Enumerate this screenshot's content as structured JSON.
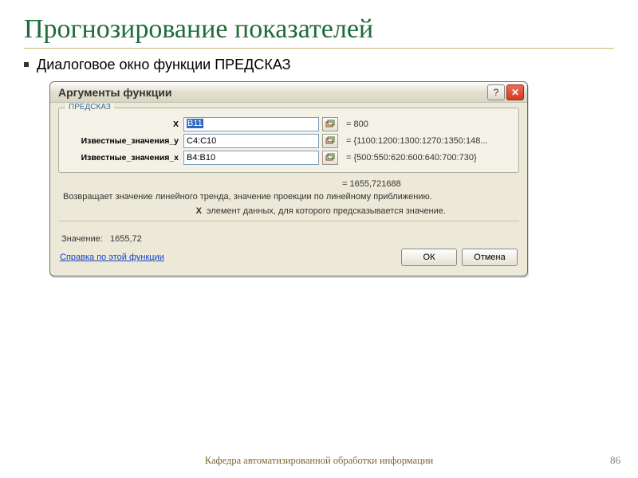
{
  "slide": {
    "title": "Прогнозирование  показателей",
    "bullet": "Диалоговое окно функции ПРЕДСКАЗ",
    "footer": "Кафедра автоматизированной обработки информации",
    "page_number": "86"
  },
  "dialog": {
    "title": "Аргументы функции",
    "help_icon": "?",
    "close_icon": "✕",
    "function_name": "ПРЕДСКАЗ",
    "arguments": [
      {
        "label": "X",
        "value": "B11",
        "highlighted": true,
        "result": "= 800"
      },
      {
        "label": "Известные_значения_y",
        "value": "C4:C10",
        "highlighted": false,
        "result": "= {1100:1200:1300:1270:1350:148..."
      },
      {
        "label": "Известные_значения_x",
        "value": "B4:B10",
        "highlighted": false,
        "result": "= {500:550:620:600:640:700:730}"
      }
    ],
    "overall_result": "= 1655,721688",
    "description": "Возвращает значение линейного тренда, значение проекции по линейному приближению.",
    "current_arg_label": "X",
    "current_arg_desc": "элемент данных, для которого предсказывается значение.",
    "value_label": "Значение:",
    "value": "1655,72",
    "help_link": "Справка по этой функции",
    "ok": "ОК",
    "cancel": "Отмена"
  }
}
